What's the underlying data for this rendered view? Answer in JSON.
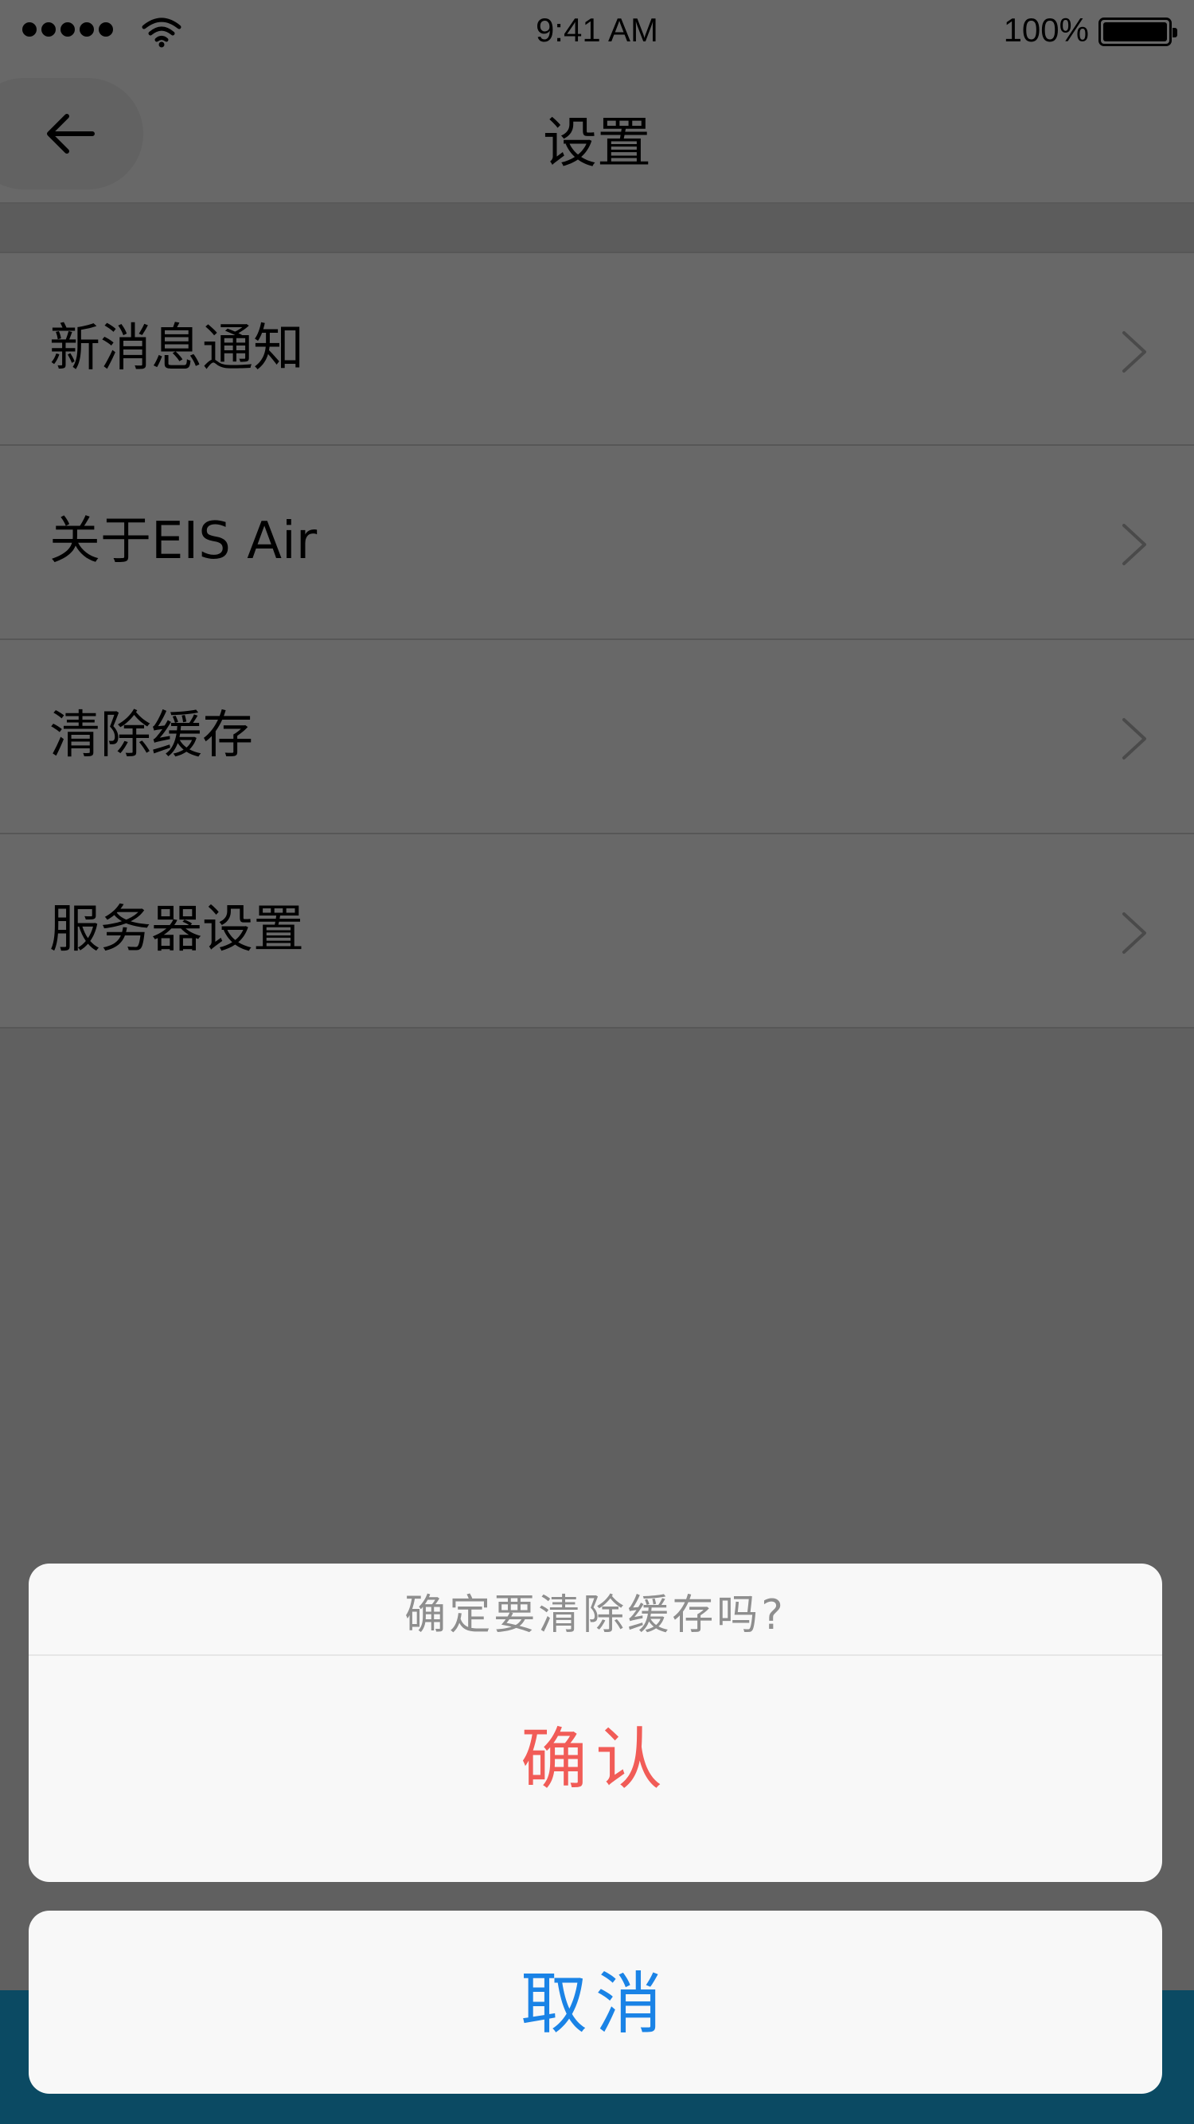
{
  "status_bar": {
    "time": "9:41 AM",
    "battery": "100%",
    "signal_icon": "signal-dots-icon",
    "wifi_icon": "wifi-icon",
    "battery_icon": "battery-icon"
  },
  "nav": {
    "title": "设置",
    "back_icon": "arrow-left-icon"
  },
  "settings": {
    "items": [
      {
        "label": "新消息通知",
        "icon": "chevron-right-icon"
      },
      {
        "label": "关于EIS Air",
        "icon": "chevron-right-icon"
      },
      {
        "label": "清除缓存",
        "icon": "chevron-right-icon"
      },
      {
        "label": "服务器设置",
        "icon": "chevron-right-icon"
      }
    ]
  },
  "action_sheet": {
    "message": "确定要清除缓存吗?",
    "confirm_label": "确认",
    "cancel_label": "取消"
  },
  "colors": {
    "overlay_background": "#606060",
    "confirm_text": "#f15c57",
    "cancel_text": "#1a83e6",
    "sheet_background": "#f8f8f8",
    "bottom_bar": "#0b4a63"
  }
}
